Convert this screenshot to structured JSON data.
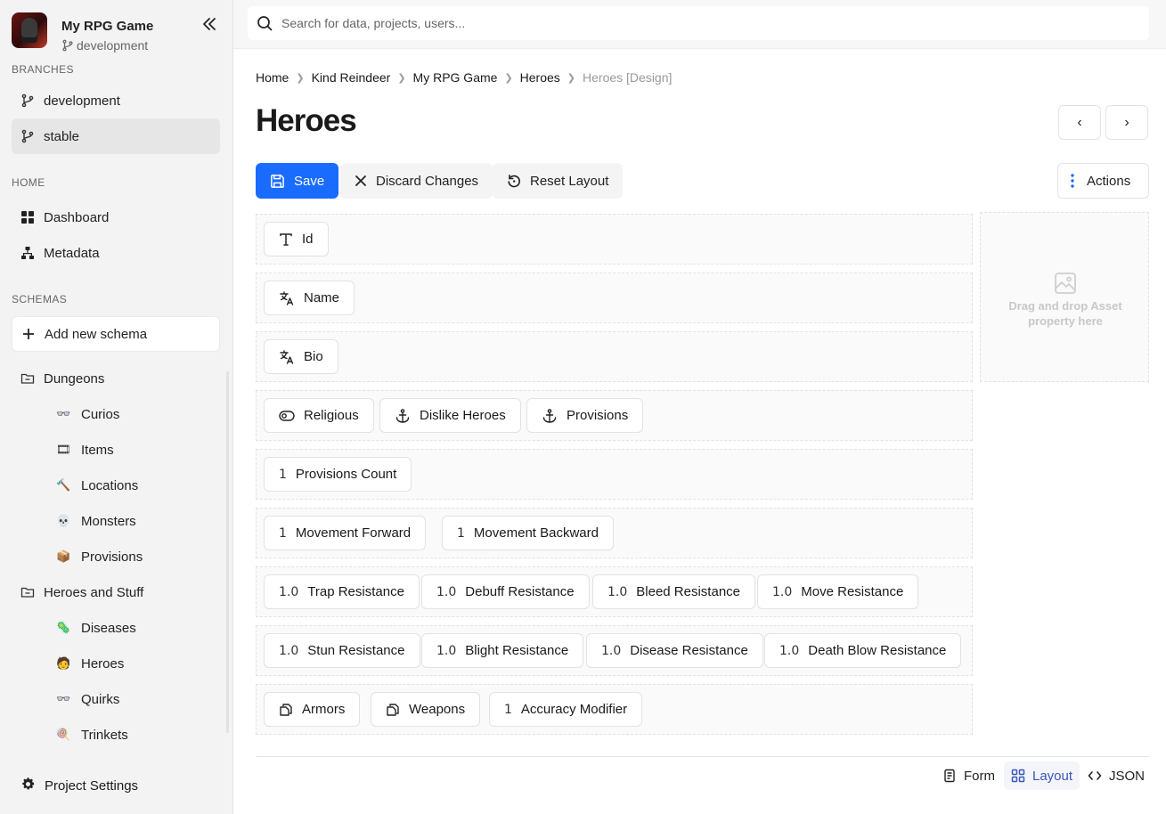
{
  "project": {
    "name": "My RPG Game",
    "branch": "development"
  },
  "sidebar": {
    "branches_label": "BRANCHES",
    "branches": [
      {
        "label": "development"
      },
      {
        "label": "stable"
      }
    ],
    "home_label": "HOME",
    "home_items": [
      {
        "label": "Dashboard",
        "icon": "dashboard-icon"
      },
      {
        "label": "Metadata",
        "icon": "hierarchy-icon"
      }
    ],
    "schemas_label": "SCHEMAS",
    "add_schema_label": "Add new schema",
    "folders": [
      {
        "label": "Dungeons",
        "items": [
          {
            "label": "Curios",
            "emoji": "👓"
          },
          {
            "label": "Items",
            "emoji": "🎞"
          },
          {
            "label": "Locations",
            "emoji": "🔨"
          },
          {
            "label": "Monsters",
            "emoji": "💀"
          },
          {
            "label": "Provisions",
            "emoji": "📦"
          }
        ]
      },
      {
        "label": "Heroes and Stuff",
        "items": [
          {
            "label": "Diseases",
            "emoji": "🦠"
          },
          {
            "label": "Heroes",
            "emoji": "🧑"
          },
          {
            "label": "Quirks",
            "emoji": "👓"
          },
          {
            "label": "Trinkets",
            "emoji": "🍭"
          }
        ]
      }
    ],
    "settings_label": "Project Settings"
  },
  "search": {
    "placeholder": "Search for data, projects, users..."
  },
  "breadcrumb": [
    "Home",
    "Kind Reindeer",
    "My RPG Game",
    "Heroes",
    "Heroes [Design]"
  ],
  "page": {
    "title": "Heroes"
  },
  "toolbar": {
    "save": "Save",
    "discard": "Discard Changes",
    "reset": "Reset Layout",
    "actions": "Actions"
  },
  "layout_rows": [
    [
      {
        "label": "Id",
        "icon": "T"
      }
    ],
    [
      {
        "label": "Name",
        "icon": "translate"
      }
    ],
    [
      {
        "label": "Bio",
        "icon": "translate"
      }
    ],
    [
      {
        "label": "Religious",
        "icon": "toggle"
      },
      {
        "label": "Dislike Heroes",
        "icon": "anchor"
      },
      {
        "label": "Provisions",
        "icon": "anchor"
      }
    ],
    [
      {
        "label": "Provisions Count",
        "icon": "1"
      }
    ],
    [
      {
        "label": "Movement Forward",
        "icon": "1"
      },
      {
        "label": "Movement Backward",
        "icon": "1"
      }
    ],
    [
      {
        "label": "Trap Resistance",
        "icon": "1.0"
      },
      {
        "label": "Debuff Resistance",
        "icon": "1.0"
      },
      {
        "label": "Bleed Resistance",
        "icon": "1.0"
      },
      {
        "label": "Move Resistance",
        "icon": "1.0"
      }
    ],
    [
      {
        "label": "Stun Resistance",
        "icon": "1.0"
      },
      {
        "label": "Blight Resistance",
        "icon": "1.0"
      },
      {
        "label": "Disease Resistance",
        "icon": "1.0"
      },
      {
        "label": "Death Blow Resistance",
        "icon": "1.0"
      }
    ],
    [
      {
        "label": "Armors",
        "icon": "copy"
      },
      {
        "label": "Weapons",
        "icon": "copy"
      },
      {
        "label": "Accuracy Modifier",
        "icon": "1"
      }
    ]
  ],
  "asset_drop": {
    "text": "Drag and drop Asset property here"
  },
  "view_tabs": [
    {
      "label": "Form"
    },
    {
      "label": "Layout",
      "active": true
    },
    {
      "label": "JSON"
    }
  ],
  "colors": {
    "primary": "#1a6bff",
    "active_tab": "#3a57b8",
    "sidebar_bg": "#f3f3f3"
  }
}
